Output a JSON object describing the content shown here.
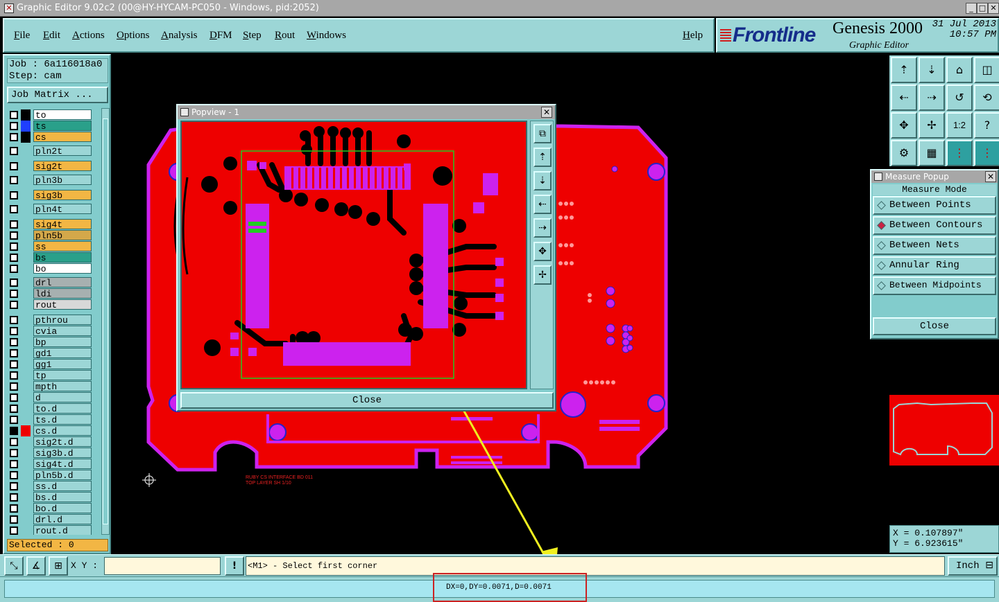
{
  "window": {
    "title": "Graphic Editor 9.02c2 (00@HY-HYCAM-PC050 - Windows, pid:2052)",
    "minimize": "_",
    "maximize": "□",
    "close": "✕"
  },
  "menu": {
    "items": [
      "File",
      "Edit",
      "Actions",
      "Options",
      "Analysis",
      "DFM",
      "Step",
      "Rout",
      "Windows"
    ],
    "help": "Help"
  },
  "brand": {
    "logo": "Frontline",
    "product": "Genesis 2000",
    "subtitle": "Graphic Editor",
    "date": "31 Jul 2013",
    "time": "10:57 PM"
  },
  "job": {
    "job_label": "Job : 6a116018a0",
    "step_label": "Step: cam",
    "matrix_button": "Job Matrix ..."
  },
  "layers": [
    {
      "name": "to",
      "swatch": "#000000",
      "bg": "#ffffff"
    },
    {
      "name": "ts",
      "swatch": "#1f3fff",
      "bg": "#2aa08a"
    },
    {
      "name": "cs",
      "swatch": "#000000",
      "bg": "#f2b644"
    },
    {
      "name": "pln2t",
      "swatch": "#82cccc",
      "bg": "#9cd6d6"
    },
    {
      "name": "sig2t",
      "swatch": "#82cccc",
      "bg": "#f2b644"
    },
    {
      "name": "pln3b",
      "swatch": "#82cccc",
      "bg": "#9cd6d6"
    },
    {
      "name": "sig3b",
      "swatch": "#82cccc",
      "bg": "#f2b644"
    },
    {
      "name": "pln4t",
      "swatch": "#82cccc",
      "bg": "#9cd6d6"
    },
    {
      "name": "sig4t",
      "swatch": "#82cccc",
      "bg": "#f2b644"
    },
    {
      "name": "pln5b",
      "swatch": "#82cccc",
      "bg": "#d4a84a"
    },
    {
      "name": "ss",
      "swatch": "#82cccc",
      "bg": "#f2b644"
    },
    {
      "name": "bs",
      "swatch": "#82cccc",
      "bg": "#2aa08a"
    },
    {
      "name": "bo",
      "swatch": "#82cccc",
      "bg": "#ffffff"
    },
    {
      "name": "drl",
      "swatch": "#82cccc",
      "bg": "#a7b0b0"
    },
    {
      "name": "ldi",
      "swatch": "#82cccc",
      "bg": "#a7b0b0"
    },
    {
      "name": "rout",
      "swatch": "#82cccc",
      "bg": "#d8d8d8"
    },
    {
      "name": "pthrou",
      "swatch": "#82cccc",
      "bg": "#9cd6d6"
    },
    {
      "name": "cvia",
      "swatch": "#82cccc",
      "bg": "#9cd6d6"
    },
    {
      "name": "bp",
      "swatch": "#82cccc",
      "bg": "#9cd6d6"
    },
    {
      "name": "gd1",
      "swatch": "#82cccc",
      "bg": "#9cd6d6"
    },
    {
      "name": "gg1",
      "swatch": "#82cccc",
      "bg": "#9cd6d6"
    },
    {
      "name": "tp",
      "swatch": "#82cccc",
      "bg": "#9cd6d6"
    },
    {
      "name": "mpth",
      "swatch": "#82cccc",
      "bg": "#9cd6d6"
    },
    {
      "name": "d",
      "swatch": "#82cccc",
      "bg": "#9cd6d6"
    },
    {
      "name": "to.d",
      "swatch": "#82cccc",
      "bg": "#9cd6d6"
    },
    {
      "name": "ts.d",
      "swatch": "#82cccc",
      "bg": "#9cd6d6"
    },
    {
      "name": "cs.d",
      "swatch": "#ee0000",
      "bg": "#9cd6d6"
    },
    {
      "name": "sig2t.d",
      "swatch": "#82cccc",
      "bg": "#9cd6d6"
    },
    {
      "name": "sig3b.d",
      "swatch": "#82cccc",
      "bg": "#9cd6d6"
    },
    {
      "name": "sig4t.d",
      "swatch": "#82cccc",
      "bg": "#9cd6d6"
    },
    {
      "name": "pln5b.d",
      "swatch": "#82cccc",
      "bg": "#9cd6d6"
    },
    {
      "name": "ss.d",
      "swatch": "#82cccc",
      "bg": "#9cd6d6"
    },
    {
      "name": "bs.d",
      "swatch": "#82cccc",
      "bg": "#9cd6d6"
    },
    {
      "name": "bo.d",
      "swatch": "#82cccc",
      "bg": "#9cd6d6"
    },
    {
      "name": "drl.d",
      "swatch": "#82cccc",
      "bg": "#9cd6d6"
    },
    {
      "name": "rout.d",
      "swatch": "#82cccc",
      "bg": "#9cd6d6"
    }
  ],
  "selected": "Selected : 0",
  "popview": {
    "title": "Popview - 1",
    "close": "Close"
  },
  "board_label": {
    "line1": "RUBY CS INTERFACE BD 011",
    "line2": "TOP LAYER SH 1/10"
  },
  "measure": {
    "title": "Measure Popup",
    "heading": "Measure Mode",
    "options": [
      {
        "label": "Between Points",
        "selected": false
      },
      {
        "label": "Between Contours",
        "selected": true
      },
      {
        "label": "Between Nets",
        "selected": false
      },
      {
        "label": "Annular Ring",
        "selected": false
      },
      {
        "label": "Between Midpoints",
        "selected": false
      }
    ],
    "close": "Close"
  },
  "coords": {
    "x": "X = 0.107897\"",
    "y": "Y = 6.923615\""
  },
  "command": {
    "xy_label": "X Y :",
    "xy_value": "",
    "prompt": "<M1> - Select first corner",
    "units": "Inch"
  },
  "status": {
    "measurement": "DX=0,DY=0.0071,D=0.0071"
  },
  "colors": {
    "panel": "#9cd6d6",
    "board_copper": "#ee0000",
    "board_outline": "#cc22ee",
    "pad": "#cc22ee",
    "highlight_arrow": "#f0f020",
    "status_box": "#cc2222"
  }
}
